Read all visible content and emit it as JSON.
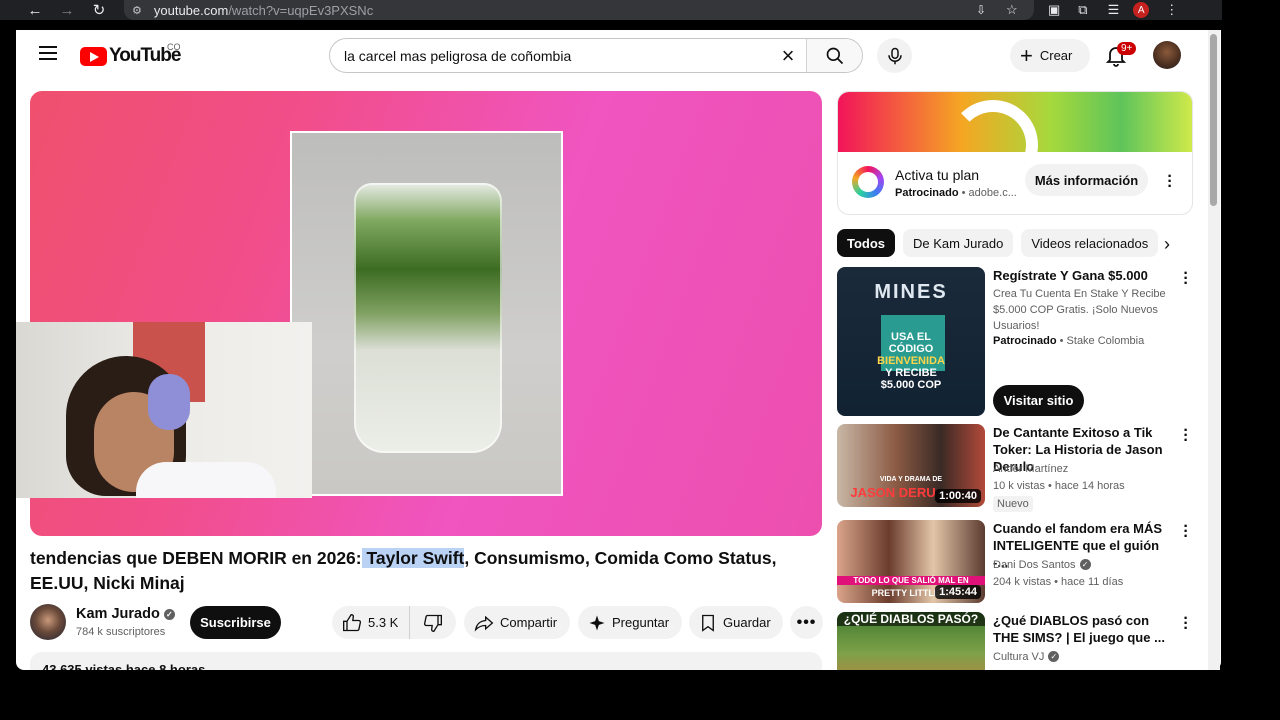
{
  "browser": {
    "url_host": "youtube.com",
    "url_path": "/watch?v=uqpEv3PXSNc",
    "profile_initial": "A"
  },
  "header": {
    "logo_text": "YouTube",
    "country": "CO",
    "search_value": "la carcel mas peligrosa de coñombia",
    "create_label": "Crear",
    "notification_count": "9+"
  },
  "video": {
    "title_before": "tendencias que DEBEN MORIR en 2026:",
    "title_highlight": " Taylor Swift",
    "title_after": ", Consumismo, Comida Como Status, EE.UU, Nicki Minaj",
    "channel": "Kam Jurado",
    "subscribers": "784 k suscriptores",
    "subscribe_label": "Suscribirse",
    "likes": "5.3 K",
    "share_label": "Compartir",
    "ask_label": "Preguntar",
    "save_label": "Guardar",
    "views_time": "43.635 vistas  hace 8 horas"
  },
  "ad": {
    "title": "Activa tu plan",
    "sponsored": "Patrocinado",
    "domain": "adobe.c...",
    "cta": "Más información"
  },
  "chips": [
    "Todos",
    "De Kam Jurado",
    "Videos relacionados"
  ],
  "recommendations": [
    {
      "title": "Regístrate Y Gana $5.000",
      "description": "Crea Tu Cuenta En Stake Y Recibe $5.000 COP Gratis. ¡Solo Nuevos Usuarios!",
      "sponsored": "Patrocinado",
      "advertiser": "Stake Colombia",
      "cta": "Visitar sitio",
      "thumb_heading": "MINES",
      "thumb_lines": [
        "USA EL",
        "CÓDIGO",
        "BIENVENIDA",
        "Y RECIBE",
        "$5.000 COP"
      ]
    },
    {
      "title": "De Cantante Exitoso a Tik Toker: La Historia de Jason Derulo",
      "channel": "Ander Martínez",
      "meta": "10 k vistas • hace 14 horas",
      "badge": "Nuevo",
      "duration": "1:00:40",
      "thumb_small": "VIDA Y DRAMA DE",
      "thumb_big": "JASON DERU"
    },
    {
      "title": "Cuando el fandom era MÁS INTELIGENTE que el guión -...",
      "channel": "Dani Dos Santos",
      "meta": "204 k vistas • hace 11 días",
      "duration": "1:45:44",
      "thumb_line1": "TODO LO QUE SALIÓ MAL EN",
      "thumb_line2": "PRETTY LITTLE LI"
    },
    {
      "title": "¿Qué DIABLOS pasó con THE SIMS? | El juego que ...",
      "channel": "Cultura VJ",
      "thumb_text": "¿QUÉ DIABLOS PASÓ?"
    }
  ]
}
